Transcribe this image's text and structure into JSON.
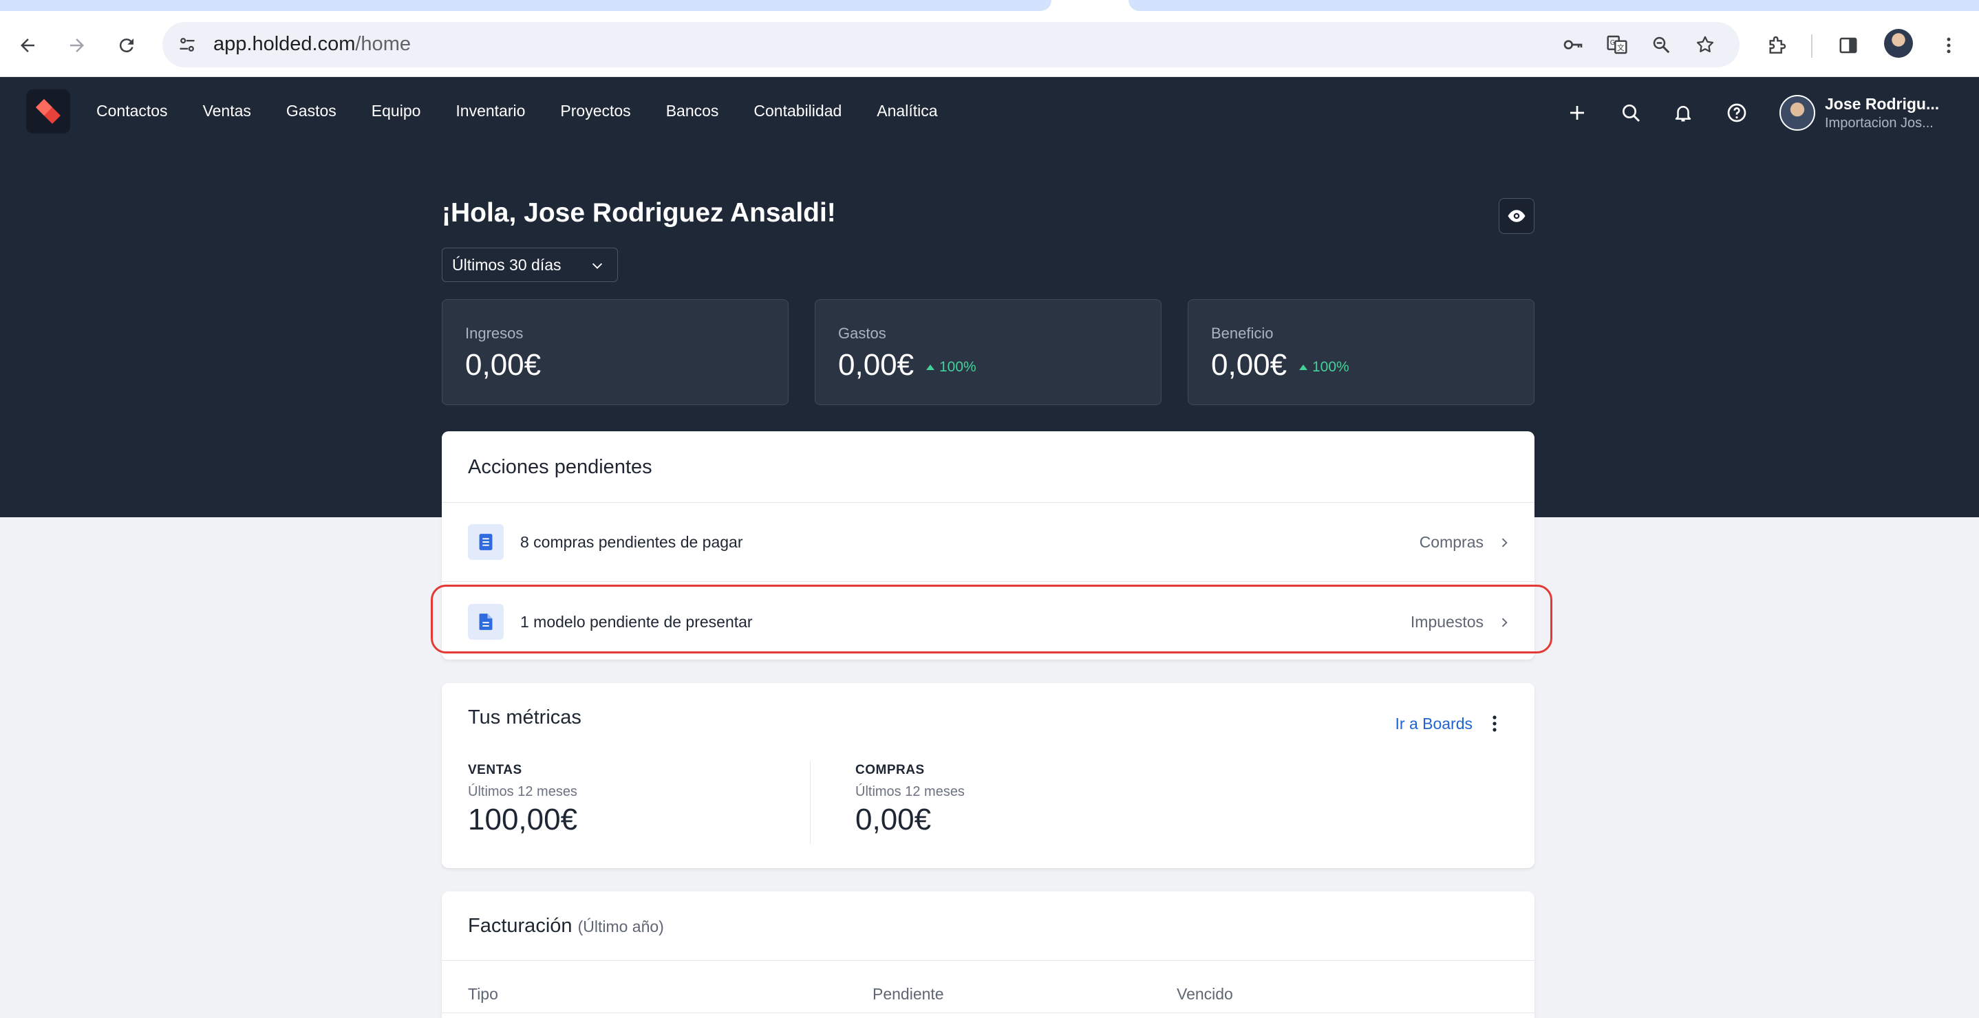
{
  "browser": {
    "url_domain": "app.holded.com",
    "url_path": "/home"
  },
  "nav": {
    "items": [
      "Contactos",
      "Ventas",
      "Gastos",
      "Equipo",
      "Inventario",
      "Proyectos",
      "Bancos",
      "Contabilidad",
      "Analítica"
    ]
  },
  "user": {
    "name": "Jose Rodrigu...",
    "company": "Importacion Jos..."
  },
  "greeting": "¡Hola, Jose Rodriguez Ansaldi!",
  "period": {
    "selected": "Últimos 30 días"
  },
  "stats": [
    {
      "label": "Ingresos",
      "value": "0,00€",
      "delta": ""
    },
    {
      "label": "Gastos",
      "value": "0,00€",
      "delta": "100%"
    },
    {
      "label": "Beneficio",
      "value": "0,00€",
      "delta": "100%"
    }
  ],
  "pending": {
    "title": "Acciones pendientes",
    "rows": [
      {
        "text": "8 compras pendientes de pagar",
        "link": "Compras"
      },
      {
        "text": "1 modelo pendiente de presentar",
        "link": "Impuestos"
      }
    ]
  },
  "metrics": {
    "title": "Tus métricas",
    "link": "Ir a Boards",
    "sales": {
      "head": "VENTAS",
      "sub": "Últimos 12 meses",
      "value": "100,00€"
    },
    "purchases": {
      "head": "COMPRAS",
      "sub": "Últimos 12 meses",
      "value": "0,00€"
    }
  },
  "billing": {
    "title": "Facturación",
    "subtitle": "(Último año)",
    "columns": [
      "Tipo",
      "Pendiente",
      "Vencido"
    ]
  },
  "colors": {
    "header_bg": "#1f2837",
    "accent_blue": "#2064d4",
    "positive": "#44d19a",
    "highlight_red": "#e53935",
    "logo_red": "#e8413b"
  }
}
